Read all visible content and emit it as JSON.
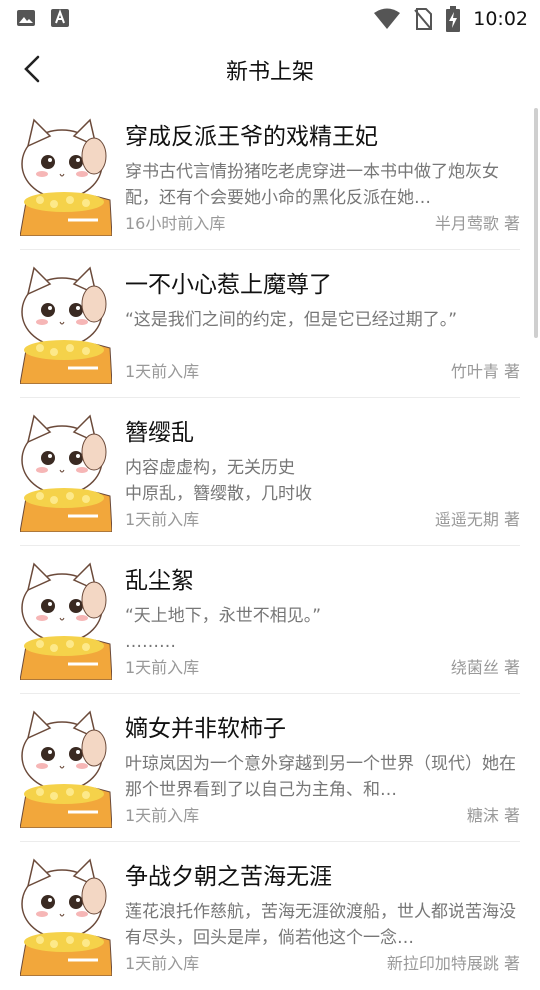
{
  "status_bar": {
    "time": "10:02",
    "icons": [
      "image-icon",
      "text-a-icon",
      "wifi-icon",
      "no-sim-icon",
      "battery-charging-icon"
    ]
  },
  "header": {
    "title": "新书上架",
    "back_icon": "chevron-left-icon"
  },
  "books": [
    {
      "title": "穿成反派王爷的戏精王妃",
      "desc": "穿书古代言情扮猪吃老虎穿进一本书中做了炮灰女配，还有个会要她小命的黑化反派在她…",
      "time": "16小时前入库",
      "author": "半月莺歌 著"
    },
    {
      "title": "一不小心惹上魔尊了",
      "desc": "“这是我们之间的约定，但是它已经过期了。”",
      "time": "1天前入库",
      "author": "竹叶青 著"
    },
    {
      "title": "簪缨乱",
      "desc": "内容虚虚构，无关历史\n中原乱，簪缨散，几时收",
      "time": "1天前入库",
      "author": "遥遥无期 著"
    },
    {
      "title": "乱尘絮",
      "desc": "“天上地下，永世不相见。”\n………",
      "time": "1天前入库",
      "author": "绕菌丝 著"
    },
    {
      "title": "嫡女并非软柿子",
      "desc": "叶琼岚因为一个意外穿越到另一个世界（现代）她在那个世界看到了以自己为主角、和…",
      "time": "1天前入库",
      "author": "糖沫 著"
    },
    {
      "title": "争战夕朝之苦海无涯",
      "desc": "莲花浪托作慈航，苦海无涯欲渡船，世人都说苦海没有尽头，回头是岸，倘若他这个一念…",
      "time": "1天前入库",
      "author": "新拉印加特展跳 著"
    }
  ],
  "colors": {
    "background": "#ffffff",
    "title_text": "#111111",
    "desc_text": "#777777",
    "meta_text": "#999999",
    "cover_bowl": "#f2a73b",
    "cover_corn": "#f5d24a"
  }
}
